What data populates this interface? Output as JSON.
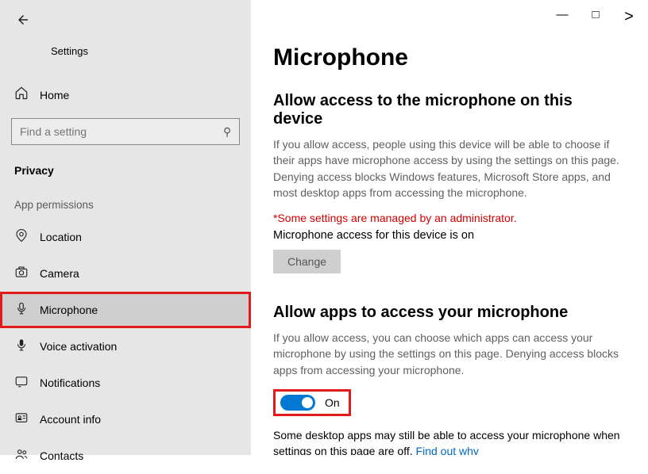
{
  "window": {
    "title": "Settings"
  },
  "sidebar": {
    "home": "Home",
    "search_placeholder": "Find a setting",
    "category": "Privacy",
    "section": "App permissions",
    "items": [
      {
        "label": "Location"
      },
      {
        "label": "Camera"
      },
      {
        "label": "Microphone"
      },
      {
        "label": "Voice activation"
      },
      {
        "label": "Notifications"
      },
      {
        "label": "Account info"
      },
      {
        "label": "Contacts"
      }
    ]
  },
  "main": {
    "title": "Microphone",
    "section1": {
      "heading": "Allow access to the microphone on this device",
      "body": "If you allow access, people using this device will be able to choose if their apps have microphone access by using the settings on this page. Denying access blocks Windows features, Microsoft Store apps, and most desktop apps from accessing the microphone.",
      "admin_note": "*Some settings are managed by an administrator.",
      "status": "Microphone access for this device is on",
      "change_btn": "Change"
    },
    "section2": {
      "heading": "Allow apps to access your microphone",
      "body": "If you allow access, you can choose which apps can access your microphone by using the settings on this page. Denying access blocks apps from accessing your microphone.",
      "toggle_state": "On",
      "footer_a": "Some desktop apps may still be able to access your microphone when settings on this page are off. ",
      "footer_link": "Find out why"
    }
  }
}
